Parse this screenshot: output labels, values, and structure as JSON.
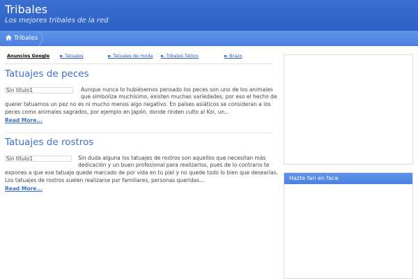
{
  "site": {
    "title": "Tribales",
    "description": "Los mejores tribales de la red"
  },
  "nav": {
    "breadcrumb_home": "Tribales"
  },
  "ads": {
    "label": "Anuncios Google",
    "links": [
      "► Tatuajes",
      "► Tatuajes de moda",
      "► Tribales Tattoo",
      "► Brazo"
    ]
  },
  "posts": [
    {
      "title": "Tatuajes de peces",
      "thumb_text": "Sin título1",
      "excerpt_lines": [
        "Aunque nunca lo hubiésemos pensado los peces son uno de los animales",
        "que simboliza muchísimo, existen muchas variedades, por eso el hecho de",
        "querer tatuarnos un pez no es ni mucho menos algo negativo. En países asiáticos se consideran a los",
        "peces como animales sagrados, por ejemplo en Japón, donde rinden culto al Koi, un..."
      ],
      "read_more": "Read More..."
    },
    {
      "title": "Tatuajes de rostros",
      "thumb_text": "Sin título1",
      "excerpt_lines": [
        "Sin duda alguna los tatuajes de rostros son aquellos que necesitan más",
        "dedicación y un buen profesional para realizarlos, pues de lo contrario te",
        "expones a que ese tatuaje quede marcado de por vida en tu piel y no quede todo lo bien que desearías.",
        "Los tatuajes de rostros suelen realizarse por familiares, personas queridas..."
      ],
      "read_more": "Read More..."
    }
  ],
  "sidebar": {
    "fan_box_title": "Hazte fan en face"
  }
}
